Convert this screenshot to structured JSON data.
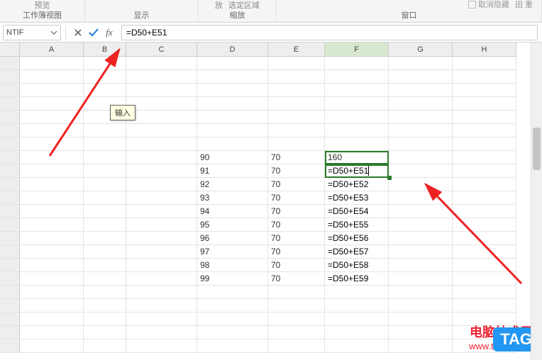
{
  "ribbon": {
    "preview_label": "预览",
    "workbook_view_label": "工作簿视图",
    "display_label": "显示",
    "zoom_sub1": "放",
    "zoom_sub2": "选定区域",
    "zoom_label": "缩放",
    "window_label": "窗口",
    "hide_checkbox": "取消隐藏",
    "grid_checkbox": "田 重"
  },
  "formula_bar": {
    "name_box": "NTIF",
    "formula": "=D50+E51",
    "tooltip_enter": "输入"
  },
  "columns": [
    "A",
    "B",
    "C",
    "D",
    "E",
    "F",
    "G",
    "H"
  ],
  "grid_data": {
    "rows": [
      {
        "D": "90",
        "E": "70",
        "F": "160",
        "is_result": true
      },
      {
        "D": "91",
        "E": "70",
        "F": "=D50+E51",
        "is_editing": true
      },
      {
        "D": "92",
        "E": "70",
        "F": "=D50+E52"
      },
      {
        "D": "93",
        "E": "70",
        "F": "=D50+E53"
      },
      {
        "D": "94",
        "E": "70",
        "F": "=D50+E54"
      },
      {
        "D": "95",
        "E": "70",
        "F": "=D50+E55"
      },
      {
        "D": "96",
        "E": "70",
        "F": "=D50+E56"
      },
      {
        "D": "97",
        "E": "70",
        "F": "=D50+E57"
      },
      {
        "D": "98",
        "E": "70",
        "F": "=D50+E58"
      },
      {
        "D": "99",
        "E": "70",
        "F": "=D50+E59"
      }
    ],
    "first_data_row_offset": 7
  },
  "watermark": {
    "main": "电脑技术网",
    "sub": "www.tagxp.com",
    "tag": "TAG"
  }
}
